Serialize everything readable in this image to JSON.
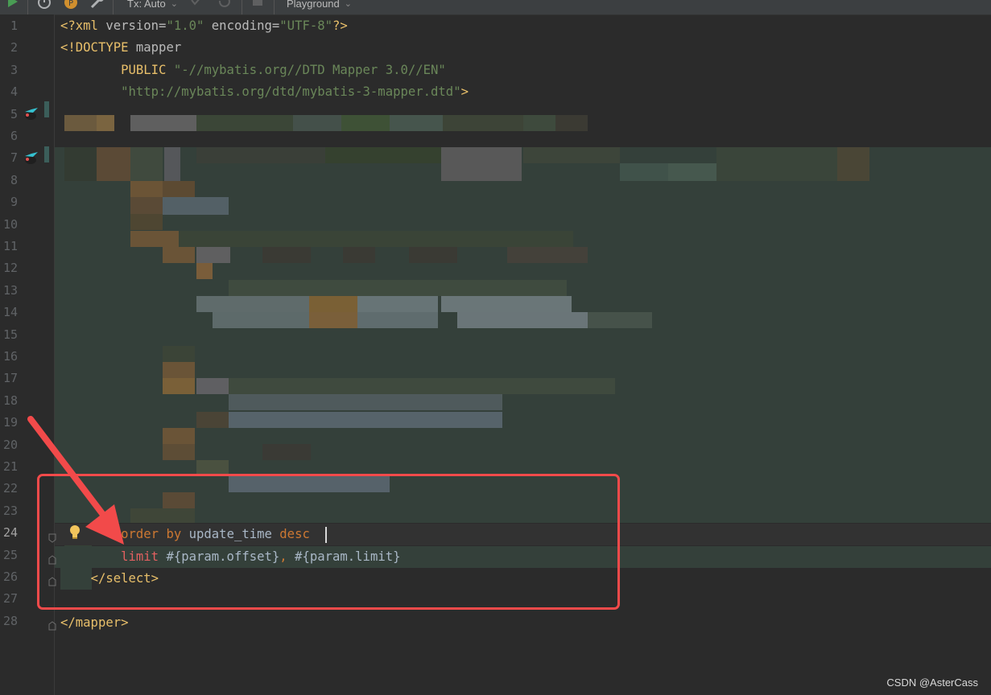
{
  "toolbar": {
    "tx_label": "Tx: Auto",
    "playground_label": "Playground"
  },
  "editor": {
    "line_numbers": [
      "1",
      "2",
      "3",
      "4",
      "5",
      "6",
      "7",
      "8",
      "9",
      "10",
      "11",
      "12",
      "13",
      "14",
      "15",
      "16",
      "17",
      "18",
      "19",
      "20",
      "21",
      "22",
      "23",
      "24",
      "25",
      "26",
      "27",
      "28"
    ],
    "active_line": "24",
    "lines": {
      "l1": {
        "open": "<?xml",
        "a1": " version=",
        "v1": "\"1.0\"",
        "a2": " encoding=",
        "v2": "\"UTF-8\"",
        "close": "?>"
      },
      "l2": {
        "open": "<!DOCTYPE",
        "rest": " mapper"
      },
      "l3": {
        "indent": "        ",
        "kw": "PUBLIC",
        "str": " \"-//mybatis.org//DTD Mapper 3.0//EN\""
      },
      "l4": {
        "indent": "        ",
        "str": "\"http://mybatis.org/dtd/mybatis-3-mapper.dtd\"",
        "close": ">"
      },
      "l24": {
        "indent": "        ",
        "order": "order",
        "by": " by",
        "col": " update_time",
        "desc": " desc"
      },
      "l25": {
        "indent": "        ",
        "limit": "limit",
        "p1": " #{param.offset}",
        "comma": ",",
        "p2": " #{param.limit}"
      },
      "l26": {
        "indent": "    ",
        "tag": "</select>"
      },
      "l28": {
        "tag": "</mapper>"
      }
    }
  },
  "watermark": "CSDN @AsterCass",
  "colors": {
    "background": "#2b2b2b",
    "tag": "#e8bf6a",
    "string": "#6a8759",
    "keyword": "#cc7832",
    "annotation_red": "#f24a4a"
  },
  "icons": [
    "run-icon",
    "history-icon",
    "commit-icon",
    "wrench-icon",
    "mapper-bird-icon",
    "lightbulb-icon",
    "fold-icon"
  ]
}
